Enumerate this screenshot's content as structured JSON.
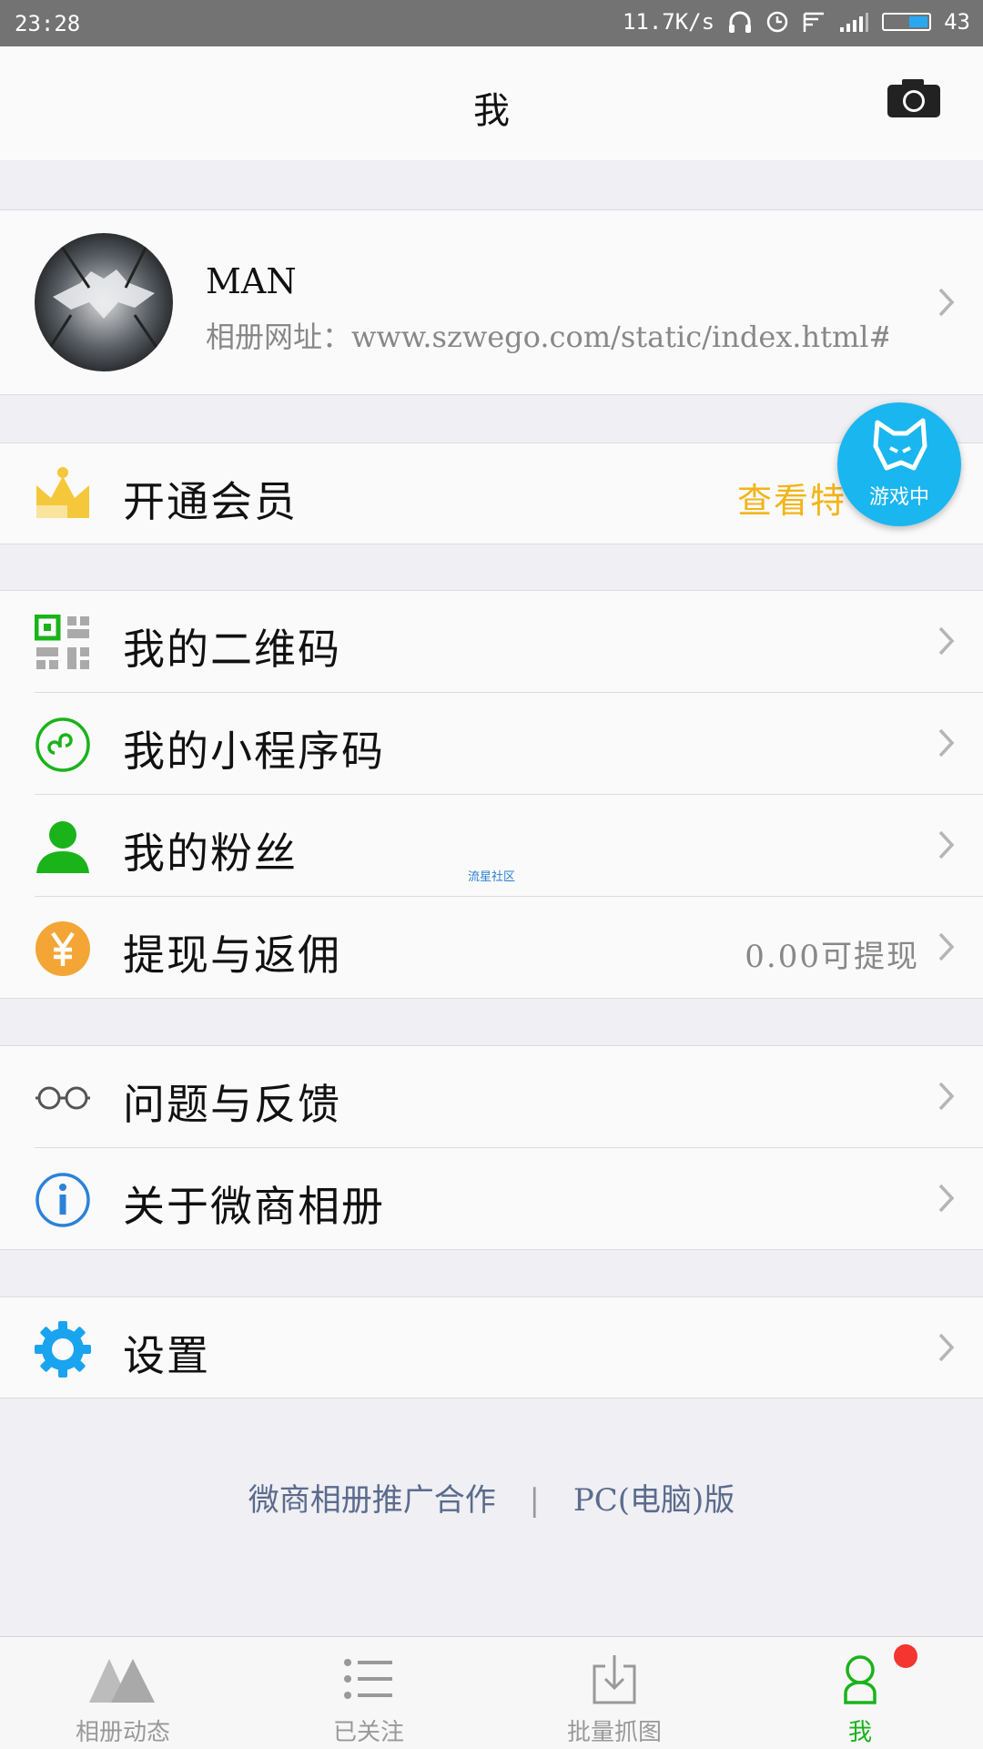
{
  "status_bar": {
    "time": "23:28",
    "speed": "11.7K/s",
    "battery": "43"
  },
  "header": {
    "title": "我"
  },
  "profile": {
    "name": "MAN",
    "album_url": "相册网址：www.szwego.com/static/index.html#/···"
  },
  "vip": {
    "label": "开通会员",
    "link": "查看特"
  },
  "menu_group_1": [
    {
      "label": "我的二维码",
      "icon": "qrcode-icon"
    },
    {
      "label": "我的小程序码",
      "icon": "mini-program-icon"
    },
    {
      "label": "我的粉丝",
      "icon": "fans-icon"
    },
    {
      "label": "提现与返佣",
      "icon": "yen-icon",
      "value": "0.00可提现"
    }
  ],
  "menu_group_2": [
    {
      "label": "问题与反馈",
      "icon": "glasses-icon"
    },
    {
      "label": "关于微商相册",
      "icon": "info-icon"
    }
  ],
  "menu_group_3": [
    {
      "label": "设置",
      "icon": "gear-icon"
    }
  ],
  "floating_button": {
    "label": "游戏中"
  },
  "watermark": "流星社区",
  "footer": {
    "promo": "微商相册推广合作",
    "separator": "|",
    "pc": "PC(电脑)版"
  },
  "tabs": [
    {
      "label": "相册动态",
      "icon": "mountains-icon"
    },
    {
      "label": "已关注",
      "icon": "list-icon"
    },
    {
      "label": "批量抓图",
      "icon": "download-icon"
    },
    {
      "label": "我",
      "icon": "user-icon",
      "active": true
    }
  ],
  "colors": {
    "accent": "#1ab31a",
    "vip_gold": "#f2b418",
    "float_blue": "#1ab6ef",
    "badge_red": "#f43530"
  }
}
